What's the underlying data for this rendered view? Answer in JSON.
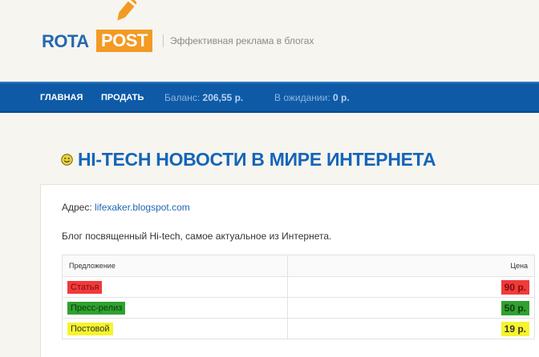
{
  "header": {
    "logo_left": "ROTA",
    "logo_right": "POST",
    "tagline": "Эффективная реклама в блогах"
  },
  "nav": {
    "items": [
      {
        "label": "ГЛАВНАЯ"
      },
      {
        "label": "ПРОДАТЬ"
      }
    ],
    "balance_label": "Баланс:",
    "balance_value": "206,55 р.",
    "pending_label": "В ожидании:",
    "pending_value": "0 р."
  },
  "page": {
    "title": "HI-TECH НОВОСТИ В МИРЕ ИНТЕРНЕТА",
    "icon": "smiley-icon",
    "address_label": "Адрес:",
    "address_value": "lifexaker.blogspot.com",
    "description": "Блог посвященный Hi-tech, самое актуальное из Интернета."
  },
  "offers": {
    "col_offer": "Предложение",
    "col_price": "Цена",
    "rows": [
      {
        "name": "Статья",
        "price": "90 р.",
        "highlight": "#f23a3a"
      },
      {
        "name": "Пресс-релиз",
        "price": "50 р.",
        "highlight": "#2fa12f"
      },
      {
        "name": "Постовой",
        "price": "19 р.",
        "highlight": "#f7f42a"
      }
    ]
  },
  "colors": {
    "brand_blue": "#1565b8",
    "brand_orange": "#f39a24",
    "nav_bg": "#0e5aa6"
  }
}
